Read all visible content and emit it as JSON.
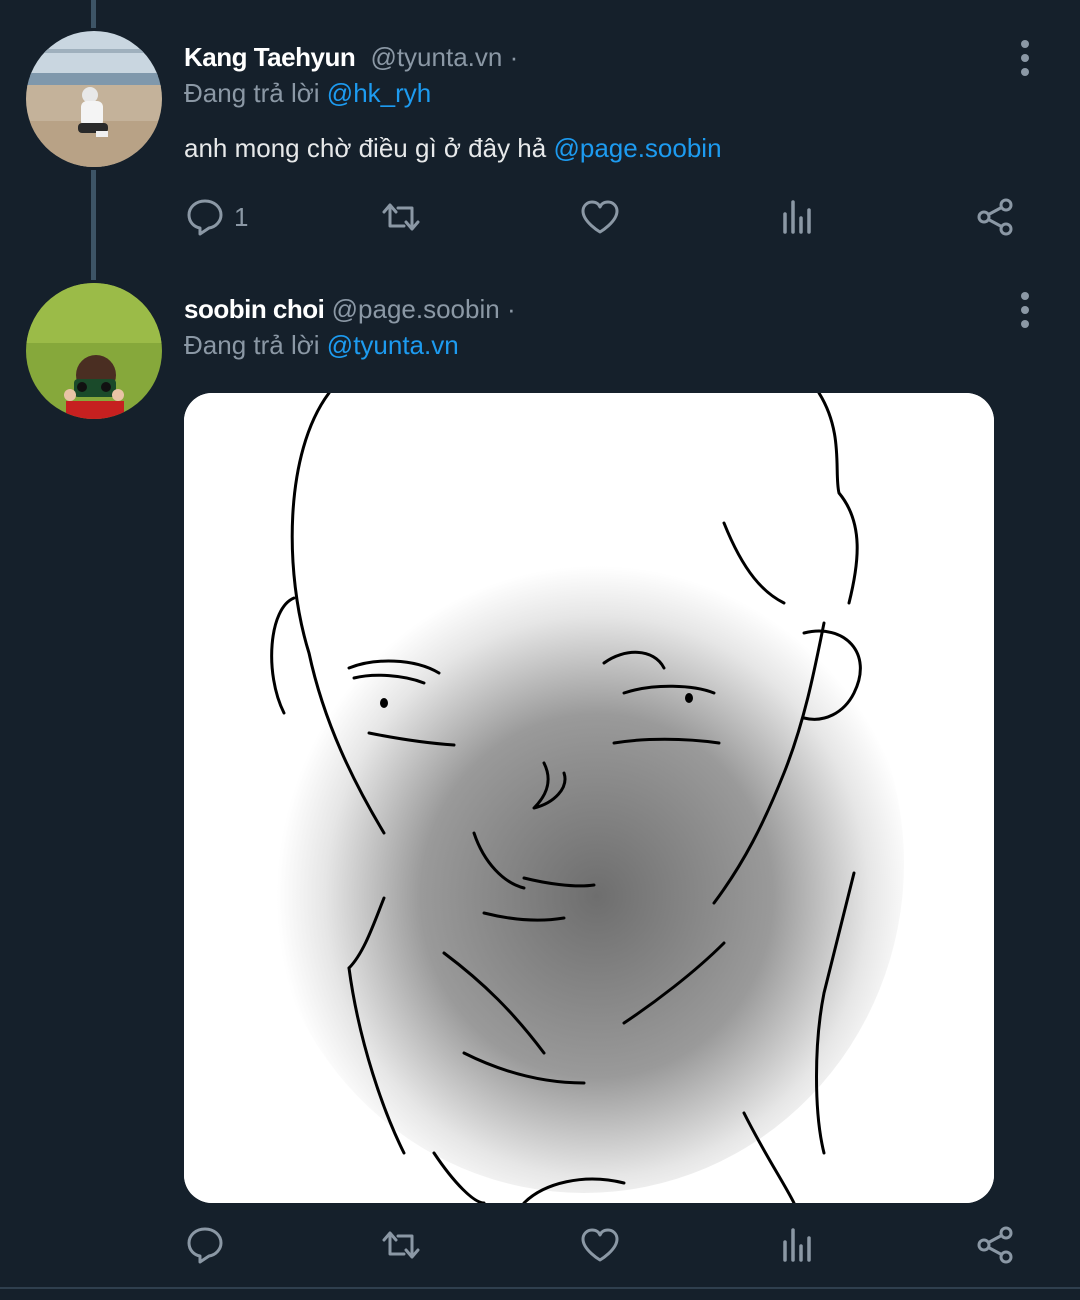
{
  "tweets": [
    {
      "display_name": "Kang Taehyun",
      "handle": "@tyunta.vn",
      "separator": "·",
      "replying_prefix": "Đang trả lời",
      "replying_to": "@hk_ryh",
      "text": "anh mong chờ điều gì ở đây hả",
      "text_mention": "@page.soobin",
      "reply_count": "1",
      "avatar_icon": "beach-photo-avatar"
    },
    {
      "display_name": "soobin choi",
      "handle": "@page.soobin",
      "separator": "·",
      "replying_prefix": "Đang trả lời",
      "replying_to": "@tyunta.vn",
      "reply_count": "",
      "avatar_icon": "grass-photo-avatar",
      "media_icon": "face-sketch-image"
    }
  ],
  "icons": {
    "reply": "reply-icon",
    "retweet": "retweet-icon",
    "like": "heart-icon",
    "views": "analytics-icon",
    "share": "share-icon",
    "more": "more-vertical-icon"
  },
  "colors": {
    "background": "#15202b",
    "accent": "#1d9bf0",
    "muted": "#8b98a5",
    "thread_line": "#3d5466",
    "text": "#e7e9ea"
  }
}
